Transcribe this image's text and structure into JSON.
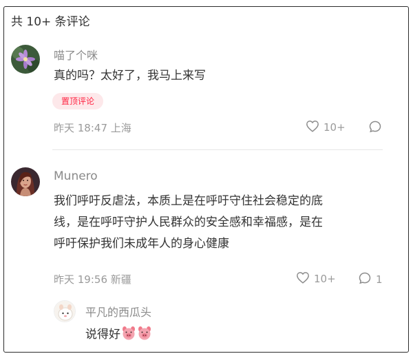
{
  "header": {
    "count_label": "共 10+ 条评论"
  },
  "comments": [
    {
      "username": "喵了个咪",
      "text": "真的吗？太好了，我马上来写",
      "badge": "置顶评论",
      "time_location": "昨天 18:47 上海",
      "likes": "10+",
      "replies": ""
    },
    {
      "username": "Munero",
      "text_lines": [
        "我们呼吁反虐法，本质上是在呼吁守住社会稳定的底",
        "线，是在呼吁守护人民群众的安全感和幸福感，是在",
        "呼吁保护我们未成年人的身心健康"
      ],
      "time_location": "昨天 19:56 新疆",
      "likes": "10+",
      "replies": "1"
    }
  ],
  "reply": {
    "username": "平凡的西瓜头",
    "text": "说得好",
    "emojis": [
      "pig-face-emoji",
      "pig-face-emoji"
    ]
  },
  "icons": {
    "like": "heart-outline-icon",
    "comment": "speech-bubble-icon"
  },
  "colors": {
    "accent": "#ff2442",
    "badge_bg": "#fde8ea",
    "muted": "#9a9a9a",
    "text": "#333333"
  }
}
